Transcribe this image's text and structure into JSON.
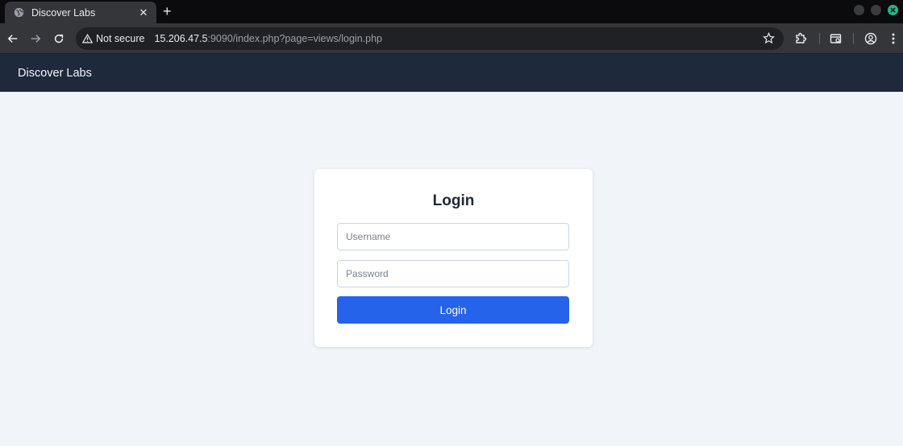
{
  "browser": {
    "tab": {
      "title": "Discover Labs",
      "close_label": "✕",
      "favicon": "globe-icon"
    },
    "new_tab_label": "+",
    "security_chip": {
      "icon": "warning-triangle-icon",
      "label": "Not secure"
    },
    "url": {
      "host": "15.206.47.5",
      "rest": ":9090/index.php?page=views/login.php"
    },
    "icons": [
      "back-icon",
      "forward-icon",
      "reload-icon",
      "bookmark-star-icon",
      "extensions-icon",
      "tab-search-icon",
      "profile-icon",
      "menu-icon"
    ]
  },
  "site": {
    "brand": "Discover Labs"
  },
  "login_form": {
    "title": "Login",
    "username_placeholder": "Username",
    "password_placeholder": "Password",
    "submit_label": "Login"
  },
  "colors": {
    "header_bg": "#1e293b",
    "page_bg": "#f1f4f9",
    "accent": "#2563eb",
    "window_close": "#1fb88f"
  }
}
